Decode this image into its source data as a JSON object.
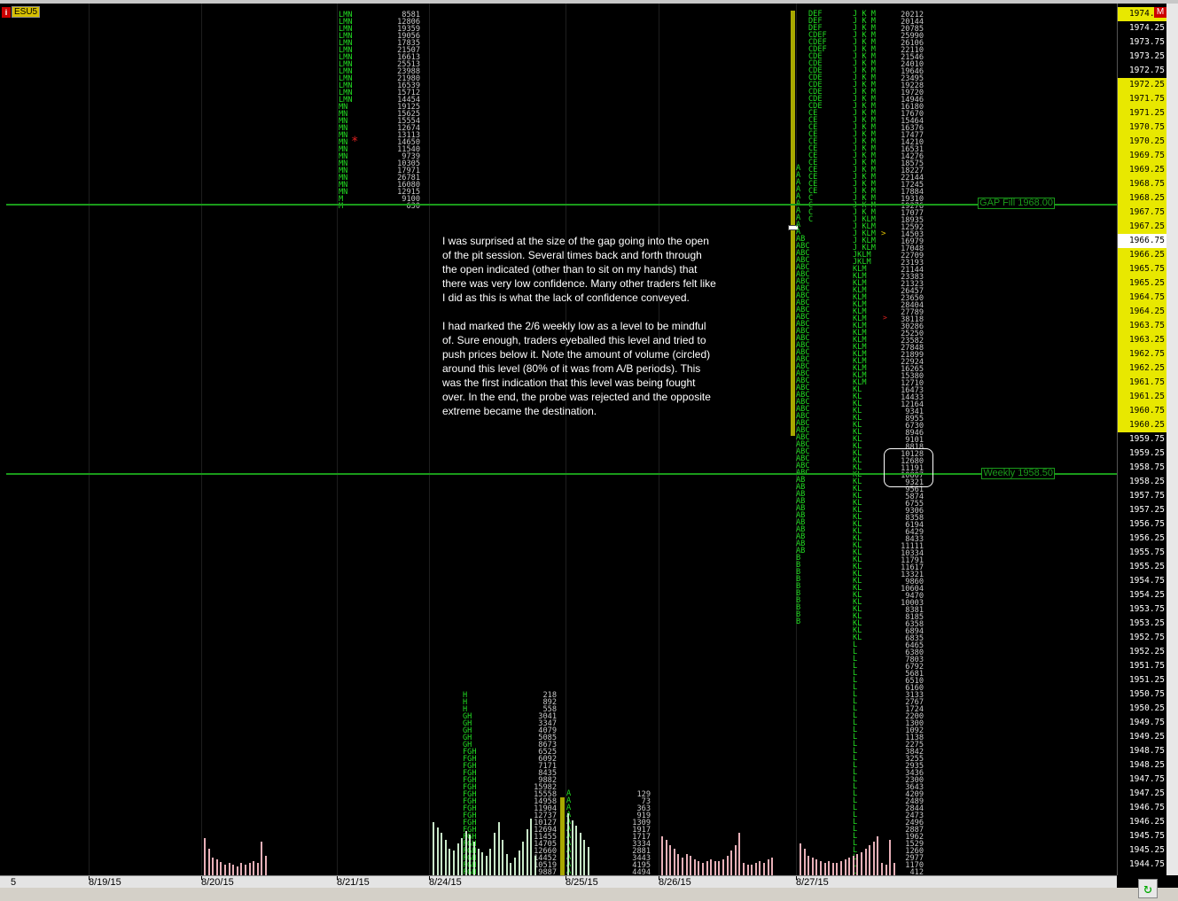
{
  "symbol": {
    "icon_text": "i",
    "name": "ESU5"
  },
  "corner_marker": "M",
  "prices": [
    "1974.75",
    "1974.25",
    "1973.75",
    "1973.25",
    "1972.75",
    "1972.25",
    "1971.75",
    "1971.25",
    "1970.75",
    "1970.25",
    "1969.75",
    "1969.25",
    "1968.75",
    "1968.25",
    "1967.75",
    "1967.25",
    "1966.75",
    "1966.25",
    "1965.75",
    "1965.25",
    "1964.75",
    "1964.25",
    "1963.75",
    "1963.25",
    "1962.75",
    "1962.25",
    "1961.75",
    "1961.25",
    "1960.75",
    "1960.25",
    "1959.75",
    "1959.25",
    "1958.75",
    "1958.25",
    "1957.75",
    "1957.25",
    "1956.75",
    "1956.25",
    "1955.75",
    "1955.25",
    "1954.75",
    "1954.25",
    "1953.75",
    "1953.25",
    "1952.75",
    "1952.25",
    "1951.75",
    "1951.25",
    "1950.75",
    "1950.25",
    "1949.75",
    "1949.25",
    "1948.75",
    "1948.25",
    "1947.75",
    "1947.25",
    "1946.75",
    "1946.25",
    "1945.75",
    "1945.25",
    "1944.75"
  ],
  "dates": [
    "8/19/15",
    "8/20/15",
    "8/21/15",
    "8/24/15",
    "8/25/15",
    "8/26/15",
    "8/27/15"
  ],
  "first_date_fragment": "5",
  "levels": [
    {
      "label": "GAP Fill 1968.00"
    },
    {
      "label": "Weekly 1958.50"
    }
  ],
  "note": {
    "p1": "I was surprised at the size of the gap going into the open of the pit session. Several times back and forth through the open indicated (other than to sit on my hands) that there was very low confidence. Many other traders felt like I did as this is what the lack of confidence conveyed.",
    "p2": "I had marked the 2/6 weekly low as a level to be mindful of. Sure enough, traders eyeballed this level and tried to push prices below it. Note the amount of volume (circled) around this level (80% of it was from A/B periods). This was the first indication that this level was being fought over. In the end, the probe was rejected and the opposite extreme became the destination."
  },
  "profiles": {
    "d821_letters": "LMN\nLMN\nLMN\nLMN\nLMN\nLMN\nLMN\nLMN\nLMN\nLMN\nLMN\nLMN\nLMN\nMN\nMN\nMN\nMN\nMN\nMN\nMN\nMN\nMN\nMN\nMN\nMN\nMN\nM\nM",
    "d821_volumes": "8581\n12806\n19359\n19056\n17835\n21507\n16613\n25513\n23988\n21980\n16539\n15712\n14454\n19125\n15625\n15554\n12674\n13113\n14650\n11540\n9739\n10305\n17971\n26781\n16080\n12915\n9100\n630",
    "d824_letters": "H\nH\nH\nGH\nGH\nGH\nGH\nGH\nFGH\nFGH\nFGH\nFGH\nFGH\nFGH\nFGH\nFGH\nFGH\nFGH\nFGH\nFGH\nFGH\nFGH\nFGH\nFGH\nFGH\nFGH",
    "d824_volumes": "218\n892\n558\n3041\n3347\n4079\n5085\n8673\n6525\n6092\n7171\n8435\n9882\n15982\n15558\n14958\n11904\n12737\n10127\n12694\n11455\n14705\n12660\n14452\n10519\n9887",
    "d825_letters": "A\nA\nA\nA\nA\nA\nA\nA\nA\nA\nA\nA\nAD\nAD",
    "d825_volumes": "129\n73\n363\n919\n1309\n1917\n1717\n3334\n2881\n3443\n4195\n4494",
    "d827_a_letters": "A\nA\nA\nA\nA\nA\nA\nA\nA\nA\nAB\nABC\nABC\nABC\nABC\nABC\nABC\nABC\nABC\nABC\nABC\nABC\nABC\nABC\nABC\nABC\nABC\nABC\nABC\nABC\nABC\nABC\nABC\nABC\nABC\nABC\nABC\nABC\nABC\nABC\nABC\nABC\nABC\nABC\nAB\nAB\nAB\nAB\nAB\nAB\nAB\nAB\nAB\nAB\nAB\nB\nB\nB\nB\nB\nB\nB\nB\nB\nB",
    "d827_c_letters": "DEF\nDEF\nDEF\nCDEF\nCDEF\nCDEF\nCDE\nCDE\nCDE\nCDE\nCDE\nCDE\nCDE\nCDE\nCE\nCE\nCE\nCE\nCE\nCE\nCE\nCE\nCE\nCE\nCE\nCE\nC\nC\nC\nC",
    "d827_j_letters": "J K M\nJ K M\nJ K M\nJ K M\nJ K M\nJ K M\nJ K M\nJ K M\nJ K M\nJ K M\nJ K M\nJ K M\nJ K M\nJ K M\nJ K M\nJ K M\nJ K M\nJ K M\nJ K M\nJ K M\nJ K M\nJ K M\nJ K M\nJ K M\nJ K M\nJ K M\nJ K M\nJ K M\nJ K M\nJ KLM\nJ KLM\nJ KLM\nJ KLM\nJ KLM\nJKLM\nJKLM\nKLM\nKLM\nKLM\nKLM\nKLM\nKLM\nKLM\nKLM\nKLM\nKLM\nKLM\nKLM\nKLM\nKLM\nKLM\nKLM\nKLM\nKL\nKL\nKL\nKL\nKL\nKL\nKL\nKL\nKL\nKL\nKL\nKL\nKL\nKL\nKL\nKL\nKL\nKL\nKL\nKL\nKL\nKL\nKL\nKL\nKL\nKL\nKL\nKL\nKL\nKL\nKL\nKL\nKL\nKL\nKL\nKL\nL\nL\nL\nL\nL\nL\nL\nL\nL\nL\nL\nL\nL\nL\nL\nL\nL\nL\nL\nL\nL\nL\nL\nL\nL\nL\nL\nL\nL\nL\nL\nL\nL\nL\nL\nL",
    "d827_volumes": "20212\n20144\n20785\n25990\n26106\n22110\n21546\n24010\n19646\n23495\n19228\n19720\n14946\n16180\n17670\n15464\n16376\n17477\n14210\n16531\n14276\n18575\n18227\n22144\n17245\n17884\n19310\n19276\n17077\n18935\n12592\n14503\n16979\n17048\n22709\n23193\n21144\n23383\n21323\n26457\n23650\n28404\n27789\n38118\n30286\n25250\n23582\n27848\n21899\n22924\n16265\n15380\n12710\n16473\n14433\n12164\n9341\n8955\n6730\n8946\n9101\n8818\n10128\n12680\n11191\n10807\n9321\n9561\n5874\n6755\n9306\n8358\n6194\n6429\n8433\n11111\n10334\n11791\n11617\n13321\n9860\n10604\n9470\n10003\n8381\n8185\n6358\n6894\n6835\n6465\n6380\n7803\n6792\n5681\n6510\n6160\n3133\n2767\n1724\n2200\n1300\n1092\n1138\n2275\n3842\n3255\n2935\n3436\n2300\n3643\n4209\n2489\n2844\n2473\n2496\n2887\n1962\n1529\n1260\n2977\n1170\n412"
  }
}
